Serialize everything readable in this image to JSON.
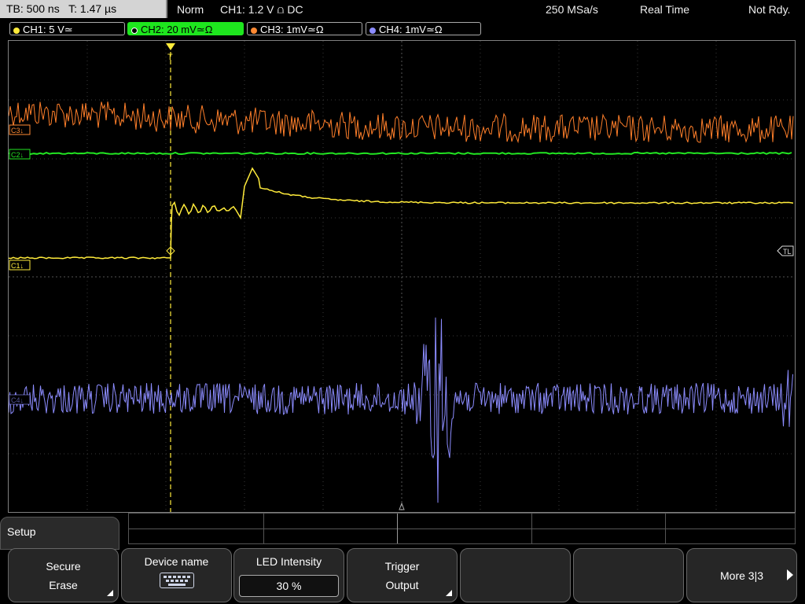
{
  "status": {
    "timebase": "TB: 500 ns",
    "trigger_time": "T: 1.47 µs",
    "mode": "Norm",
    "trigger_info": "CH1: 1.2 V ⩍ DC",
    "sample_rate": "250 MSa/s",
    "acq_mode": "Real Time",
    "state": "Not Rdy."
  },
  "channels": [
    {
      "label": "CH1: 5 V≃",
      "color": "#ffeb3b"
    },
    {
      "label": "CH2: 20 mV≃Ω",
      "color": "#22e622"
    },
    {
      "label": "CH3: 1mV≃Ω",
      "color": "#ff8a33"
    },
    {
      "label": "CH4: 1mV≃Ω",
      "color": "#8c8cff"
    }
  ],
  "markers": {
    "c3": "C3↓",
    "c2": "C2↓",
    "c1": "C1↓",
    "c4": "C4↓",
    "tl": "TL",
    "trigger": "T"
  },
  "menu": {
    "title": "Setup",
    "softkeys": [
      {
        "line1": "Secure",
        "line2": "Erase"
      },
      {
        "line1": "Device name"
      },
      {
        "line1": "LED Intensity",
        "value": "30 %"
      },
      {
        "line1": "Trigger",
        "line2": "Output"
      },
      {
        "line1": ""
      },
      {
        "line1": ""
      },
      {
        "line1": "More 3|3"
      }
    ]
  },
  "icons": {
    "keyboard": "keyboard-icon",
    "submenu": "submenu-triangle-icon",
    "more": "chevron-right-icon"
  }
}
